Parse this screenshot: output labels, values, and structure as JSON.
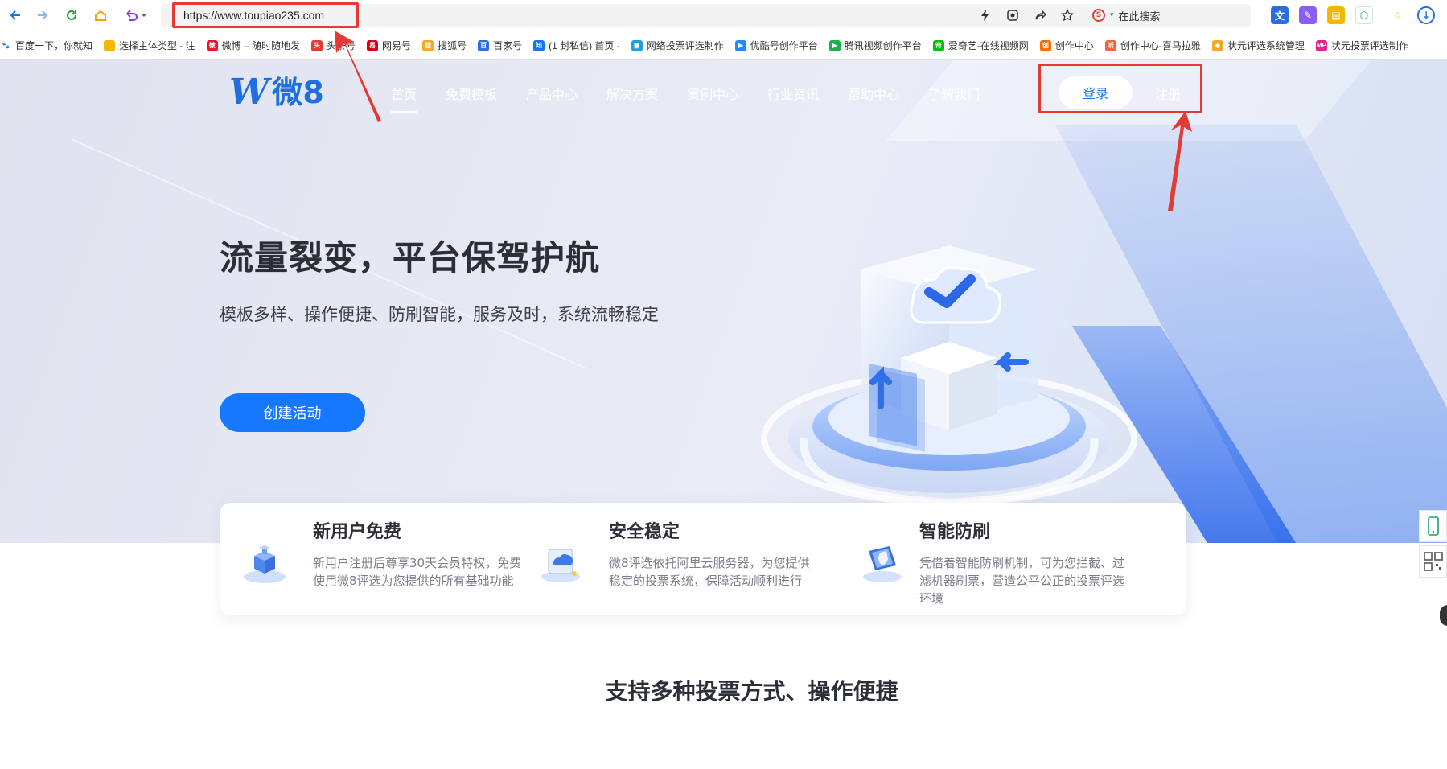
{
  "browser": {
    "url": "https://www.toupiao235.com",
    "search_placeholder": "在此搜索",
    "search_engine_glyph": "S",
    "highlight_color": "#e53935"
  },
  "bookmarks": [
    {
      "label": "百度一下，你就知",
      "color": "#ffffff",
      "glyph": "🐾"
    },
    {
      "label": "选择主体类型 - 注",
      "color": "#f5b800",
      "glyph": ""
    },
    {
      "label": "微博 – 随时随地发",
      "color": "#e6162d",
      "glyph": "微"
    },
    {
      "label": "头条号",
      "color": "#e53935",
      "glyph": "头"
    },
    {
      "label": "网易号",
      "color": "#d0021b",
      "glyph": "易"
    },
    {
      "label": "搜狐号",
      "color": "#f5a623",
      "glyph": "搜"
    },
    {
      "label": "百家号",
      "color": "#2b6de0",
      "glyph": "百"
    },
    {
      "label": "(1 封私信) 首页 -",
      "color": "#1772f6",
      "glyph": "知"
    },
    {
      "label": "网络投票评选制作",
      "color": "#1ea0e8",
      "glyph": "▣"
    },
    {
      "label": "优酷号创作平台",
      "color": "#1d8cff",
      "glyph": "▶"
    },
    {
      "label": "腾讯视频创作平台",
      "color": "#18b24b",
      "glyph": "▶"
    },
    {
      "label": "爱奇艺-在线视频网",
      "color": "#00be06",
      "glyph": "奇"
    },
    {
      "label": "创作中心",
      "color": "#ff6a00",
      "glyph": "创"
    },
    {
      "label": "创作中心-喜马拉雅",
      "color": "#f86442",
      "glyph": "听"
    },
    {
      "label": "状元评选系统管理",
      "color": "#f5a623",
      "glyph": "◆"
    },
    {
      "label": "状元投票评选制作",
      "color": "#e0218a",
      "glyph": "MP"
    }
  ],
  "header": {
    "logo_mark": "W",
    "logo_text": "微8",
    "nav": [
      "首页",
      "免费模板",
      "产品中心",
      "解决方案",
      "案例中心",
      "行业资讯",
      "帮助中心",
      "了解我们"
    ],
    "login": "登录",
    "register": "注册"
  },
  "hero": {
    "title": "流量裂变，平台保驾护航",
    "subtitle": "模板多样、操作便捷、防刷智能，服务及时，系统流畅稳定",
    "cta": "创建活动"
  },
  "features": [
    {
      "title": "新用户免费",
      "desc": "新用户注册后尊享30天会员特权，免费使用微8评选为您提供的所有基础功能"
    },
    {
      "title": "安全稳定",
      "desc": "微8评选依托阿里云服务器，为您提供稳定的投票系统，保障活动顺利进行"
    },
    {
      "title": "智能防刷",
      "desc": "凭借着智能防刷机制，可为您拦截、过滤机器刷票，营造公平公正的投票评选环境"
    }
  ],
  "section_title": "支持多种投票方式、操作便捷",
  "colors": {
    "brand": "#1677ff",
    "hero_bg": "#e6e9f4",
    "annotation": "#e53935"
  }
}
